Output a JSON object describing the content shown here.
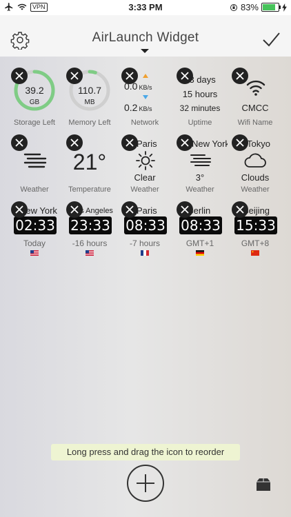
{
  "status": {
    "vpn": "VPN",
    "time": "3:33 PM",
    "battery": "83%",
    "battery_level": 0.83
  },
  "nav": {
    "title": "AirLaunch Widget"
  },
  "widgets": {
    "storage": {
      "value": "39.2",
      "unit": "GB",
      "label": "Storage Left",
      "fraction": 0.85,
      "color": "#7fcc85"
    },
    "memory": {
      "value": "110.7",
      "unit": "MB",
      "label": "Memory Left",
      "fraction": 0.05,
      "color": "#7fcc85"
    },
    "network": {
      "up": "0.0",
      "up_unit": "KB/s",
      "down": "0.2",
      "down_unit": "KB/s",
      "label": "Network",
      "up_color": "#f0a030",
      "down_color": "#4aa8e8"
    },
    "uptime": {
      "line1": "13 days",
      "line2": "15 hours",
      "line3": "32 minutes",
      "label": "Uptime"
    },
    "wifi": {
      "name": "CMCC",
      "label": "Wifi Name"
    },
    "weather1": {
      "label": "Weather",
      "icon": "fog-icon"
    },
    "temperature": {
      "value": "21°",
      "label": "Temperature"
    },
    "weather_paris": {
      "city": "Paris",
      "text": "Clear",
      "label": "Weather",
      "icon": "sun-icon"
    },
    "weather_ny": {
      "city": "New York",
      "text": "3°",
      "label": "Weather",
      "icon": "fog-icon"
    },
    "weather_tokyo": {
      "city": "Tokyo",
      "text": "Clouds",
      "label": "Weather",
      "icon": "cloud-icon"
    },
    "clock_ny": {
      "city": "New York",
      "time": "02:33",
      "sub": "Today",
      "flag": "us-flag"
    },
    "clock_la": {
      "city": "Los Angeles",
      "time": "23:33",
      "sub": "-16 hours",
      "flag": "us-flag"
    },
    "clock_paris": {
      "city": "Paris",
      "time": "08:33",
      "sub": "-7 hours",
      "flag": "fr-flag"
    },
    "clock_berlin": {
      "city": "Berlin",
      "time": "08:33",
      "sub": "GMT+1",
      "flag": "de-flag"
    },
    "clock_beijing": {
      "city": "Beijing",
      "time": "15:33",
      "sub": "GMT+8",
      "flag": "cn-flag"
    }
  },
  "hint": "Long press and drag the icon to reorder"
}
